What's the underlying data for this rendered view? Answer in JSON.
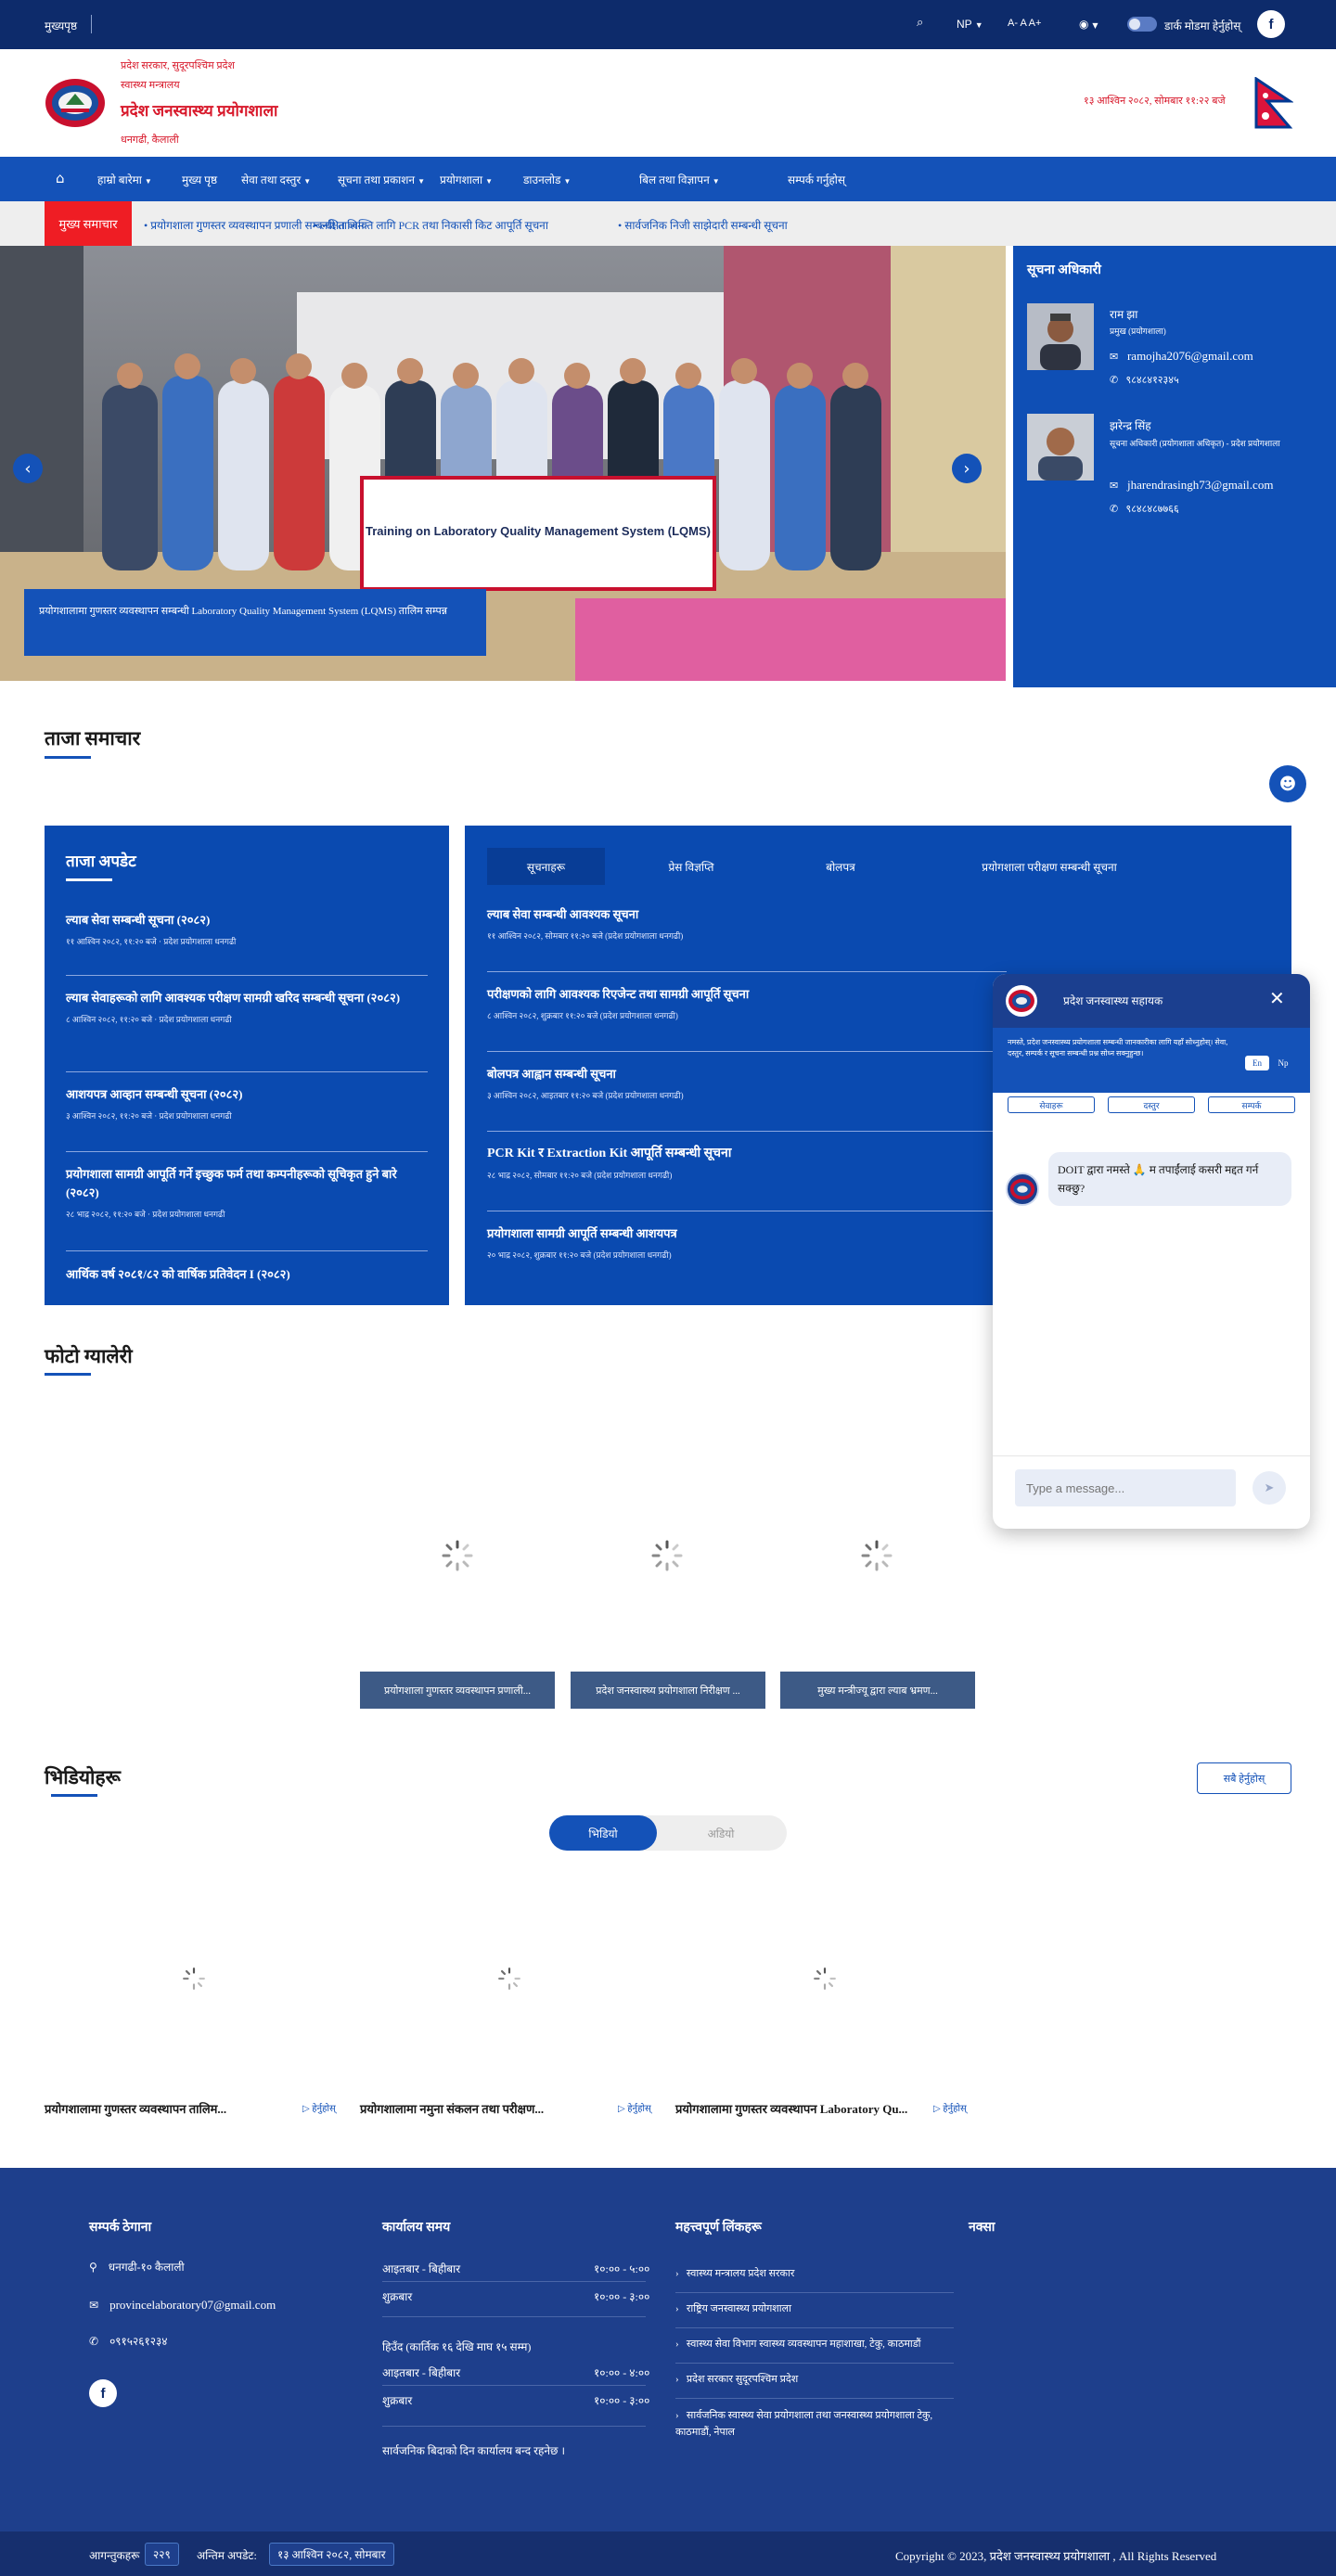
{
  "topbar": {
    "left_label": "मुख्यपृष्ठ",
    "lang": "NP",
    "font_controls": "A- A A+",
    "accessibility": "◉",
    "mode_label": "डार्क मोडमा हेर्नुहोस्"
  },
  "header": {
    "line1": "प्रदेश सरकार, सुदूरपश्चिम प्रदेश",
    "line2": "स्वास्थ्य मन्त्रालय",
    "line3": "प्रदेश जनस्वास्थ्य प्रयोगशाला",
    "line4": "धनगढी, कैलाली",
    "date": "१३ आश्विन २०८२, सोमबार ११:२२ बजे"
  },
  "nav": {
    "items": [
      {
        "label": "हाम्रो बारेमा"
      },
      {
        "label": "मुख्य पृष्ठ"
      },
      {
        "label": "सेवा तथा दस्तुर"
      },
      {
        "label": "सूचना तथा प्रकाशन"
      },
      {
        "label": "प्रयोगशाला"
      },
      {
        "label": "डाउनलोड"
      },
      {
        "label": "बिल तथा विज्ञापन"
      },
      {
        "label": "सम्पर्क गर्नुहोस्"
      }
    ]
  },
  "ticker": {
    "badge": "मुख्य समाचार",
    "items": [
      "प्रयोगशाला गुणस्तर व्यवस्थापन प्रणाली सम्बन्धी तालिम",
      "लक्षित व्यक्ति लागि PCR तथा निकासी किट आपूर्ति सूचना",
      "सार्वजनिक निजी साझेदारी सम्बन्धी सूचना"
    ]
  },
  "hero": {
    "banner_text": "Training on Laboratory Quality Management System (LQMS)",
    "caption": "प्रयोगशालामा गुणस्तर व्यवस्थापन सम्बन्धी Laboratory Quality Management System (LQMS) तालिम सम्पन्न"
  },
  "officials": {
    "title": "सूचना अधिकारी",
    "people": [
      {
        "name": "राम झा",
        "role": "प्रमुख (प्रयोगशाला)",
        "email": "ramojha2076@gmail.com",
        "phone": "९८४८४१२३४५"
      },
      {
        "name": "झरेन्द्र सिंह",
        "role": "सूचना अधिकारी (प्रयोगशाला अधिकृत) - प्रदेश प्रयोगशाला",
        "email": "jharendrasingh73@gmail.com",
        "phone": "९८४८४८७७६६"
      }
    ]
  },
  "section_news": {
    "title": "ताजा समाचार"
  },
  "news_left": {
    "title": "ताजा अपडेट",
    "items": [
      {
        "title": "ल्याब सेवा सम्बन्धी सूचना (२०८२)",
        "meta": "११ आश्विन २०८२, ११:२० बजे · प्रदेश प्रयोगशाला धनगढी"
      },
      {
        "title": "ल्याब सेवाहरूको लागि आवश्यक परीक्षण सामग्री खरिद सम्बन्धी सूचना (२०८२)",
        "meta": "८ आश्विन २०८२, ११:२० बजे · प्रदेश प्रयोगशाला धनगढी"
      },
      {
        "title": "आशयपत्र आव्हान सम्बन्धी सूचना (२०८२)",
        "meta": "३ आश्विन २०८२, ११:२० बजे · प्रदेश प्रयोगशाला धनगढी"
      },
      {
        "title": "प्रयोगशाला सामग्री आपूर्ति गर्ने इच्छुक फर्म तथा कम्पनीहरूको सूचिकृत हुने बारे (२०८२)",
        "meta": "२८ भाद्र २०८२, ११:२० बजे · प्रदेश प्रयोगशाला धनगढी"
      },
      {
        "title": "आर्थिक वर्ष २०८१/८२ को वार्षिक प्रतिवेदन I (२०८२)",
        "meta": ""
      }
    ]
  },
  "news_right": {
    "tabs": [
      "सूचनाहरू",
      "प्रेस विज्ञप्ति",
      "बोलपत्र",
      "प्रयोगशाला परीक्षण सम्बन्धी सूचना"
    ],
    "items": [
      {
        "title": "ल्याब सेवा सम्बन्धी आवश्यक सूचना",
        "meta": "११ आश्विन २०८२, सोमबार ११:२० बजे (प्रदेश प्रयोगशाला धनगढी)"
      },
      {
        "title": "परीक्षणको लागि आवश्यक रिएजेन्ट तथा सामग्री आपूर्ति सूचना",
        "meta": "८ आश्विन २०८२, शुक्रबार ११:२० बजे (प्रदेश प्रयोगशाला धनगढी)"
      },
      {
        "title": "बोलपत्र आह्वान सम्बन्धी सूचना",
        "meta": "३ आश्विन २०८२, आइतबार ११:२० बजे (प्रदेश प्रयोगशाला धनगढी)"
      },
      {
        "title": "PCR Kit र Extraction Kit आपूर्ति सम्बन्धी सूचना",
        "meta": "२८ भाद्र २०८२, सोमबार ११:२० बजे (प्रदेश प्रयोगशाला धनगढी)"
      },
      {
        "title": "प्रयोगशाला सामग्री आपूर्ति सम्बन्धी आशयपत्र",
        "meta": "२० भाद्र २०८२, शुक्रबार ११:२० बजे (प्रदेश प्रयोगशाला धनगढी)"
      }
    ]
  },
  "section_gallery": {
    "title": "फोटो ग्यालेरी",
    "captions": [
      "प्रयोगशाला गुणस्तर व्यवस्थापन प्रणाली...",
      "प्रदेश जनस्वास्थ्य प्रयोगशाला निरीक्षण ...",
      "मुख्य मन्त्रीज्यू द्वारा ल्याब भ्रमण..."
    ]
  },
  "section_videos": {
    "title": "भिडियोहरू",
    "view_all": "सबै हेर्नुहोस्",
    "toggle": [
      "भिडियो",
      "अडियो"
    ],
    "items": [
      {
        "title": "प्रयोगशालामा गुणस्तर व्यवस्थापन तालिम...",
        "more": "हेर्नुहोस्"
      },
      {
        "title": "प्रयोगशालामा नमुना संकलन तथा परीक्षण...",
        "more": "हेर्नुहोस्"
      },
      {
        "title": "प्रयोगशालामा गुणस्तर व्यवस्थापन Laboratory Qu...",
        "more": "हेर्नुहोस्"
      }
    ]
  },
  "chat": {
    "title": "प्रदेश जनस्वास्थ्य सहायक",
    "intro": "नमस्ते, प्रदेश जनस्वास्थ्य प्रयोगशाला सम्बन्धी जानकारीका लागि यहाँ सोध्नुहोस्। सेवा, दस्तुर, सम्पर्क र सूचना सम्बन्धी प्रश्न सोध्न सक्नुहुन्छ।",
    "lang_en": "En",
    "lang_np": "Np",
    "quick": [
      "सेवाहरू",
      "दस्तुर",
      "सम्पर्क"
    ],
    "message": "DOIT द्वारा नमस्ते 🙏 म तपाईंलाई कसरी मद्दत गर्न सक्छु?",
    "placeholder": "Type a message..."
  },
  "footer": {
    "contact_title": "सम्पर्क ठेगाना",
    "address": "धनगढी-१० कैलाली",
    "email": "provincelaboratory07@gmail.com",
    "phone": "०९१५२६१२३४",
    "hours_title": "कार्यालय समय",
    "hours": [
      {
        "day": "आइतबार - बिहीबार",
        "time": "१०:०० - ५:००"
      },
      {
        "day": "शुक्रबार",
        "time": "१०:०० - ३:००"
      },
      {
        "day": "हिउँद (कार्तिक १६ देखि माघ १५ सम्म)",
        "time": ""
      },
      {
        "day": "आइतबार - बिहीबार",
        "time": "१०:०० - ४:००"
      },
      {
        "day": "शुक्रबार",
        "time": "१०:०० - ३:००"
      }
    ],
    "hours_note": "सार्वजनिक बिदाको दिन कार्यालय बन्द रहनेछ ।",
    "links_title": "महत्त्वपूर्ण लिंकहरू",
    "links": [
      "स्वास्थ्य मन्त्रालय प्रदेश सरकार",
      "राष्ट्रिय जनस्वास्थ्य प्रयोगशाला",
      "स्वास्थ्य सेवा विभाग स्वास्थ्य व्यवस्थापन महाशाखा, टेकु, काठमाडौं",
      "प्रदेश सरकार सुदूरपश्चिम प्रदेश",
      "सार्वजनिक स्वास्थ्य सेवा प्रयोगशाला तथा जनस्वास्थ्य प्रयोगशाला टेकु, काठमाडौं, नेपाल"
    ],
    "map_title": "नक्सा"
  },
  "bottombar": {
    "visitors_label": "आगन्तुकहरू",
    "visitors_count": "२२९",
    "updated_label": "अन्तिम अपडेट:",
    "updated_value": "१३ आश्विन २०८२, सोमबार",
    "copyright": "Copyright © 2023, प्रदेश जनस्वास्थ्य प्रयोगशाला , All Rights Reserved"
  },
  "colors": {
    "primary": "#1452b8",
    "dark": "#0d2b6b",
    "accent_red": "#ef1d24",
    "footer": "#1e3f8c"
  }
}
